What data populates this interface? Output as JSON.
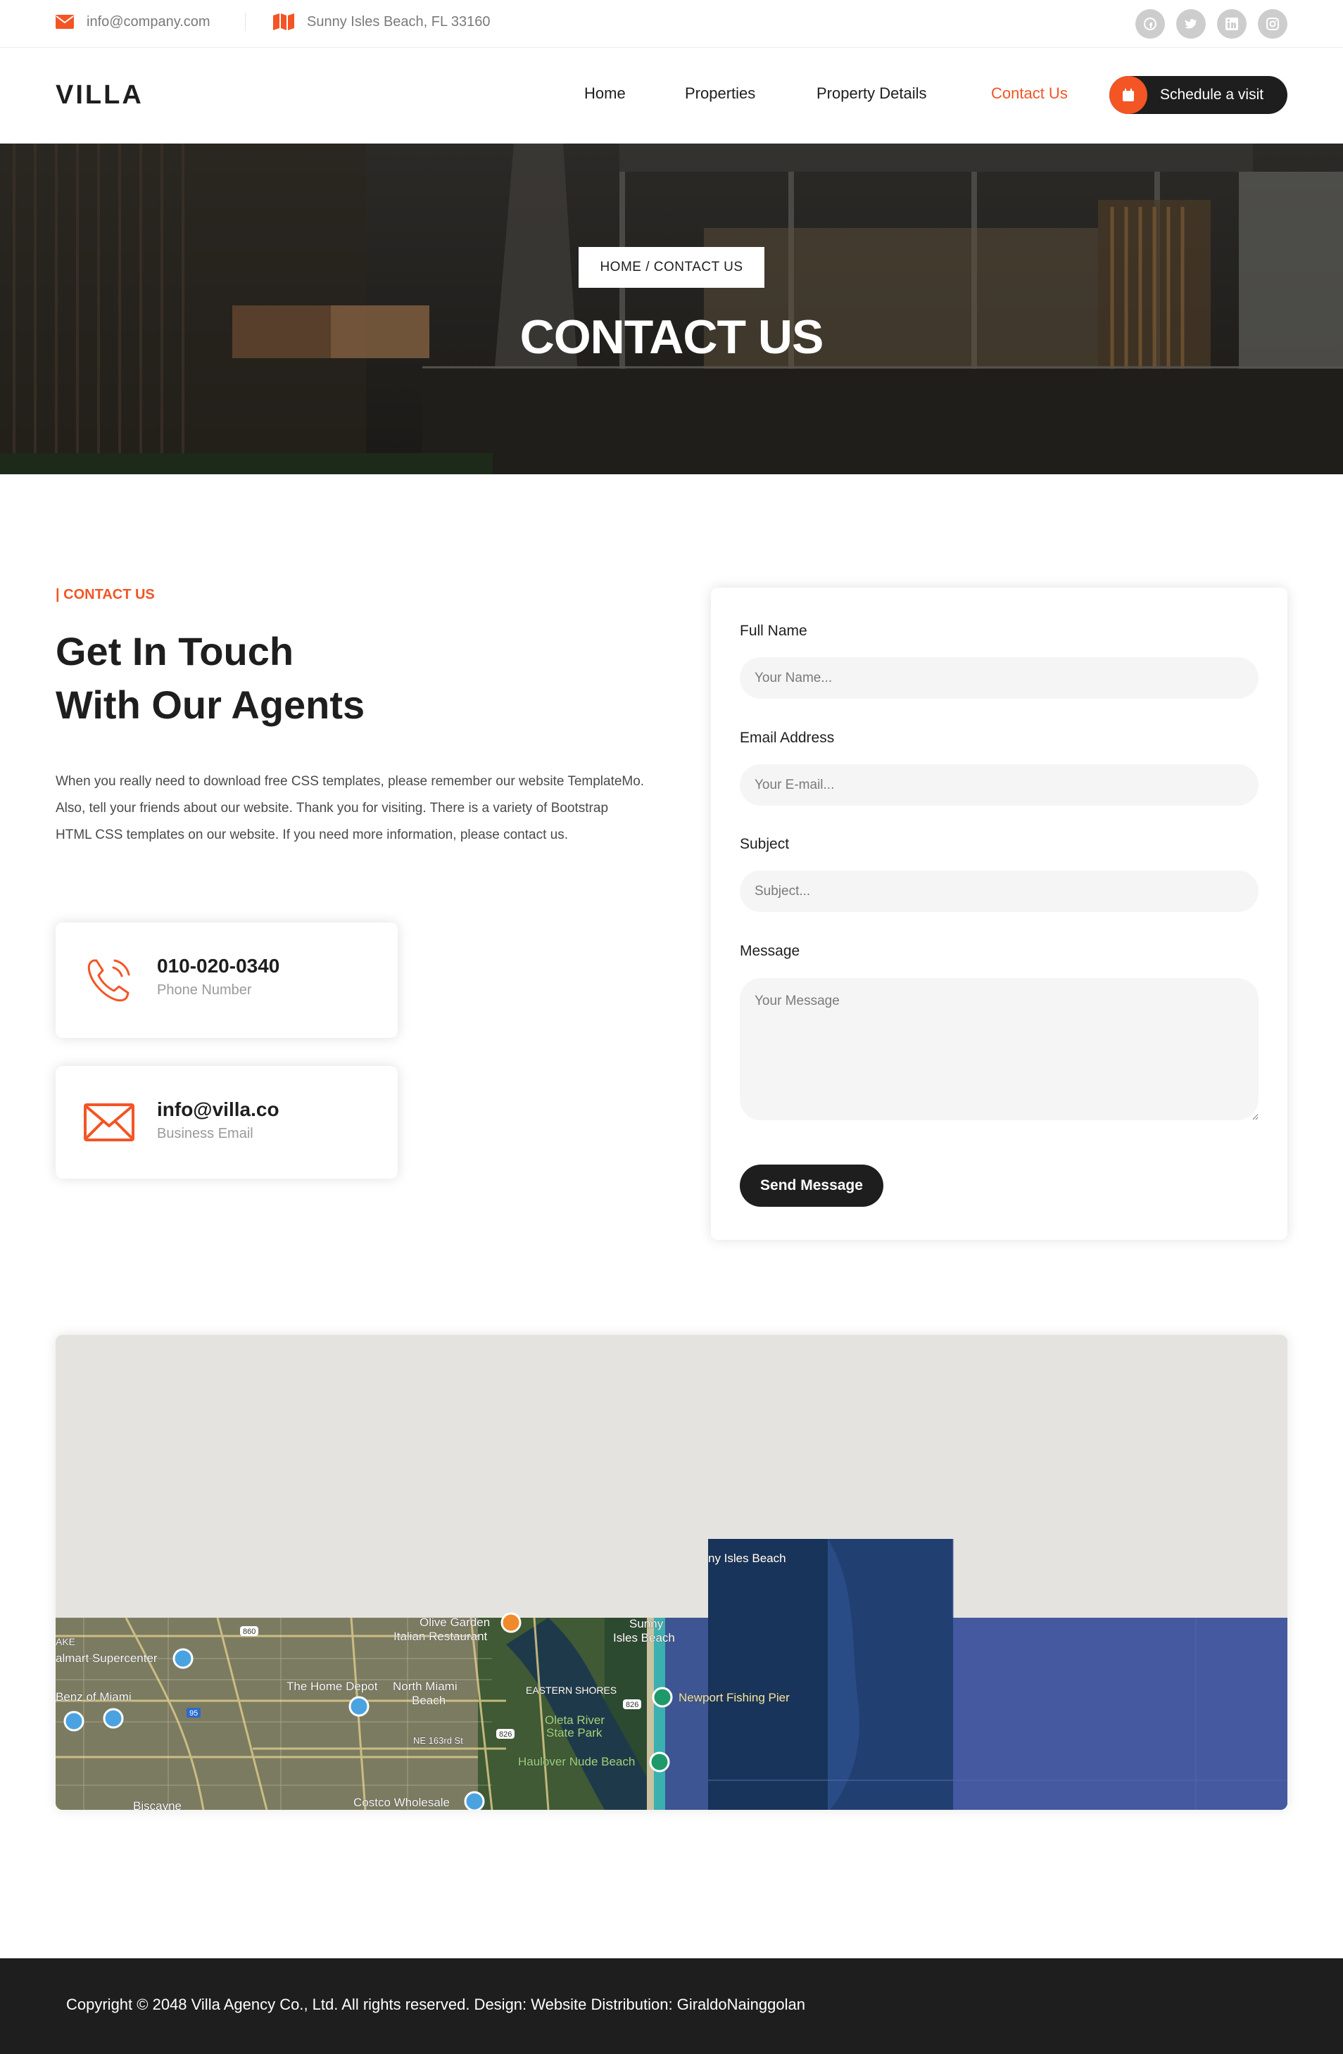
{
  "topbar": {
    "email": "info@company.com",
    "address": "Sunny Isles Beach, FL 33160",
    "email_icon": "envelope-icon",
    "address_icon": "map-icon",
    "socials": [
      "facebook-icon",
      "twitter-icon",
      "linkedin-icon",
      "instagram-icon"
    ]
  },
  "nav": {
    "logo": "VILLA",
    "items": [
      {
        "label": "Home",
        "active": false
      },
      {
        "label": "Properties",
        "active": false
      },
      {
        "label": "Property Details",
        "active": false
      },
      {
        "label": "Contact Us",
        "active": true
      }
    ],
    "cta": "Schedule a visit",
    "cta_icon": "calendar-icon"
  },
  "hero": {
    "breadcrumb": "HOME / CONTACT US",
    "title": "CONTACT US"
  },
  "contact": {
    "eyebrow": "| CONTACT US",
    "heading_line1": "Get In Touch",
    "heading_line2": "With Our Agents",
    "paragraph": "When you really need to download free CSS templates, please remember our website TemplateMo. Also, tell your friends about our website. Thank you for visiting. There is a variety of Bootstrap HTML CSS templates on our website. If you need more information, please contact us.",
    "phone": {
      "value": "010-020-0340",
      "label": "Phone Number",
      "icon": "phone-icon"
    },
    "email": {
      "value": "info@villa.co",
      "label": "Business Email",
      "icon": "envelope-icon"
    }
  },
  "form": {
    "name_label": "Full Name",
    "name_placeholder": "Your Name...",
    "email_label": "Email Address",
    "email_placeholder": "Your E-mail...",
    "subject_label": "Subject",
    "subject_placeholder": "Subject...",
    "message_label": "Message",
    "message_placeholder": "Your Message",
    "submit": "Send Message"
  },
  "map": {
    "labels": {
      "sunny_isles_top": "ny Isles Beach",
      "olive_garden": "Olive Garden",
      "olive_garden_2": "Italian Restaurant",
      "sunny_isles_1": "Sunny",
      "sunny_isles_2": "Isles Beach",
      "walmart": "almart Supercenter",
      "benz": "Benz of Miami",
      "home_depot": "The Home Depot",
      "north_miami_1": "North Miami",
      "north_miami_2": "Beach",
      "eastern_shores": "EASTERN SHORES",
      "newport": "Newport Fishing Pier",
      "oleta_1": "Oleta River",
      "oleta_2": "State Park",
      "haulover": "Haulover Nude Beach",
      "costco": "Costco Wholesale",
      "biscayne": "Biscayne",
      "ake": "AKE",
      "ne163": "NE 163rd St",
      "route_860": "860",
      "route_826a": "826",
      "route_826b": "826",
      "route_95": "95"
    }
  },
  "footer": {
    "copyright": "Copyright © 2048 Villa Agency Co., Ltd. All rights reserved. Design: Website Distribution: GiraldoNainggolan"
  },
  "colors": {
    "accent": "#f35525",
    "dark": "#1e1e1e",
    "input_bg": "#f5f5f5"
  }
}
